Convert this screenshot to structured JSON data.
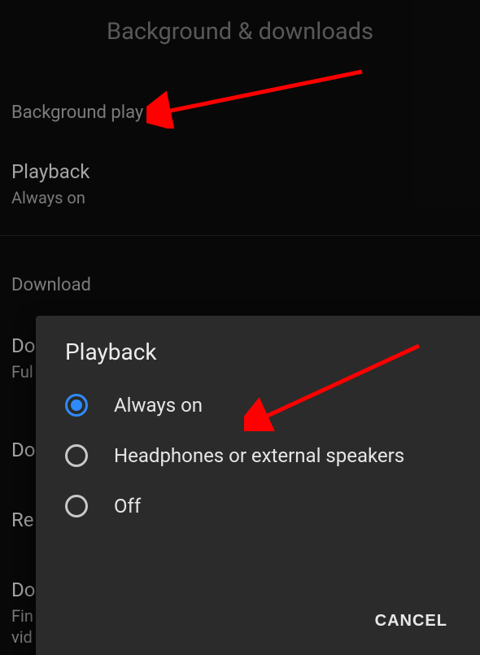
{
  "header": {
    "title": "Background & downloads"
  },
  "sections": {
    "background_play": {
      "header": "Background play",
      "playback": {
        "title": "Playback",
        "subtitle": "Always on"
      }
    },
    "download": {
      "header": "Download",
      "item1": {
        "title_fragment": "Do",
        "sub_fragment": "Ful"
      },
      "item2": {
        "title_fragment": "Do"
      },
      "item3": {
        "title_fragment": "Re"
      },
      "item4": {
        "title_fragment": "Do",
        "sub_fragment1": "Fin",
        "sub_fragment2": "vid"
      }
    }
  },
  "dialog": {
    "title": "Playback",
    "options": [
      {
        "label": "Always on",
        "selected": true
      },
      {
        "label": "Headphones or external speakers",
        "selected": false
      },
      {
        "label": "Off",
        "selected": false
      }
    ],
    "cancel": "CANCEL"
  },
  "annotations": {
    "arrow_color": "#ff0000"
  }
}
